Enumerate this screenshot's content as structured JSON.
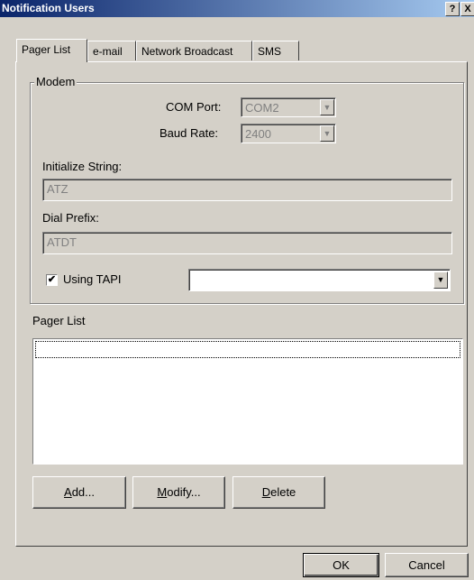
{
  "window": {
    "title": "Notification Users",
    "help": "?",
    "close": "X"
  },
  "tabs": [
    {
      "label": "Pager List",
      "active": true
    },
    {
      "label": "e-mail",
      "active": false
    },
    {
      "label": "Network Broadcast",
      "active": false
    },
    {
      "label": "SMS",
      "active": false
    }
  ],
  "modem": {
    "group_label": "Modem",
    "com_port_label": "COM Port:",
    "com_port_value": "COM2",
    "baud_rate_label": "Baud Rate:",
    "baud_rate_value": "2400",
    "init_string_label": "Initialize String:",
    "init_string_value": "ATZ",
    "dial_prefix_label": "Dial Prefix:",
    "dial_prefix_value": "ATDT",
    "using_tapi_label": "Using TAPI",
    "using_tapi_checked": true,
    "tapi_device_value": ""
  },
  "pager_list": {
    "label": "Pager List",
    "items": []
  },
  "list_buttons": {
    "add_pre": "",
    "add_key": "A",
    "add_post": "dd...",
    "modify_pre": "",
    "modify_key": "M",
    "modify_post": "odify...",
    "delete_pre": "",
    "delete_key": "D",
    "delete_post": "elete"
  },
  "dialog_buttons": {
    "ok": "OK",
    "cancel": "Cancel"
  },
  "icons": {
    "dropdown": "chevron-down-icon",
    "checkmark": "check-icon"
  }
}
